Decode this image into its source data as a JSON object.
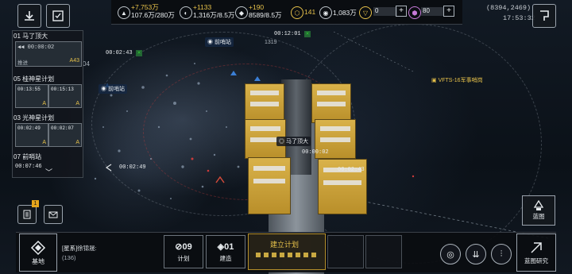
{
  "top_resources": {
    "r1": {
      "delta": "+7,753万",
      "value": "107.6万/280万"
    },
    "r2": {
      "delta": "+1133",
      "value": "1,316万/8.5万"
    },
    "r3": {
      "delta": "+190",
      "value": "8589/8.5万"
    },
    "level": "141",
    "credits": "1,083万",
    "gold": "0",
    "premium": "80"
  },
  "coords": "(8394,2469)",
  "clock": "17:53:32",
  "fleets": [
    {
      "title": "01 马了顶大",
      "timer": "00:00:02",
      "status": "推进",
      "tag": "A43"
    },
    {
      "title": "05 桂神星计划",
      "t1": "00:13:55",
      "t2": "00:15:13",
      "tag1": "A",
      "tag2": "A"
    },
    {
      "title": "03 光神星计划",
      "t1": "00:02:49",
      "t2": "00:02:07",
      "tag1": "A",
      "tag2": "A"
    },
    {
      "title": "07 前哨站",
      "timer": "00:07:46"
    }
  ],
  "map_labels": {
    "outpost1": "前哨站",
    "outpost2": "前哨站",
    "station": "VFTS-16军事哨岗",
    "ship_name": "马了顶大",
    "timer_top1": "00:12:01",
    "timer_top2": "00:02:43",
    "timer_mid": "00:00:02",
    "timer_right": "00:02:43",
    "timer_left": "00:02:49",
    "num_1319": "1319",
    "num_04": "04"
  },
  "bottom": {
    "base_label": "基地",
    "chat_channel": "[星系]",
    "chat_user": "徐锦晟:",
    "chat_count": "(136)",
    "plan_count": "09",
    "plan_label": "计划",
    "build_count": "01",
    "build_label": "建造",
    "build_plan_label": "建立计划",
    "blueprint_label": "蓝图",
    "blueprint_research_label": "蓝图研究",
    "mail_badge": "1"
  },
  "colors": {
    "gold": "#d9b24a",
    "accent": "#e6c14a",
    "blue": "#3b7fd6"
  }
}
